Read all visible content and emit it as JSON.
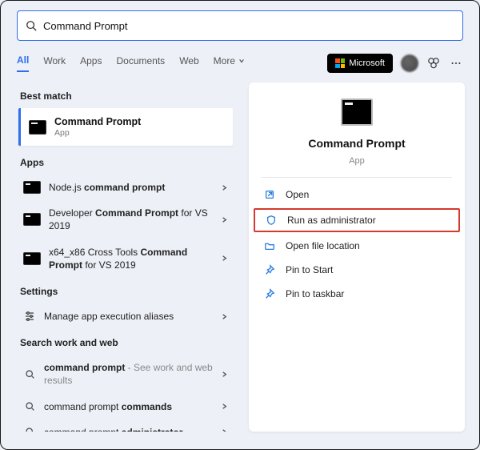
{
  "search": {
    "value": "Command Prompt"
  },
  "tabs": {
    "all": "All",
    "work": "Work",
    "apps": "Apps",
    "documents": "Documents",
    "web": "Web",
    "more": "More"
  },
  "ms_badge": "Microsoft",
  "sections": {
    "best_match": "Best match",
    "apps": "Apps",
    "settings": "Settings",
    "search_ww": "Search work and web"
  },
  "best_match": {
    "title": "Command Prompt",
    "subtitle": "App"
  },
  "apps_list": {
    "item0_pre": "Node.js ",
    "item0_bold": "command prompt",
    "item1_pre": "Developer ",
    "item1_bold": "Command Prompt",
    "item1_post": " for VS 2019",
    "item2_pre": "x64_x86 Cross Tools ",
    "item2_bold": "Command Prompt",
    "item2_post": " for VS 2019"
  },
  "settings_list": {
    "item0": "Manage app execution aliases"
  },
  "web_list": {
    "item0_bold": "command prompt",
    "item0_sub": " - See work and web results",
    "item1_pre": "command prompt ",
    "item1_bold": "commands",
    "item2_pre": "command prompt ",
    "item2_bold": "administrator"
  },
  "preview": {
    "title": "Command Prompt",
    "subtitle": "App"
  },
  "actions": {
    "open": "Open",
    "run_admin": "Run as administrator",
    "open_loc": "Open file location",
    "pin_start": "Pin to Start",
    "pin_taskbar": "Pin to taskbar"
  }
}
